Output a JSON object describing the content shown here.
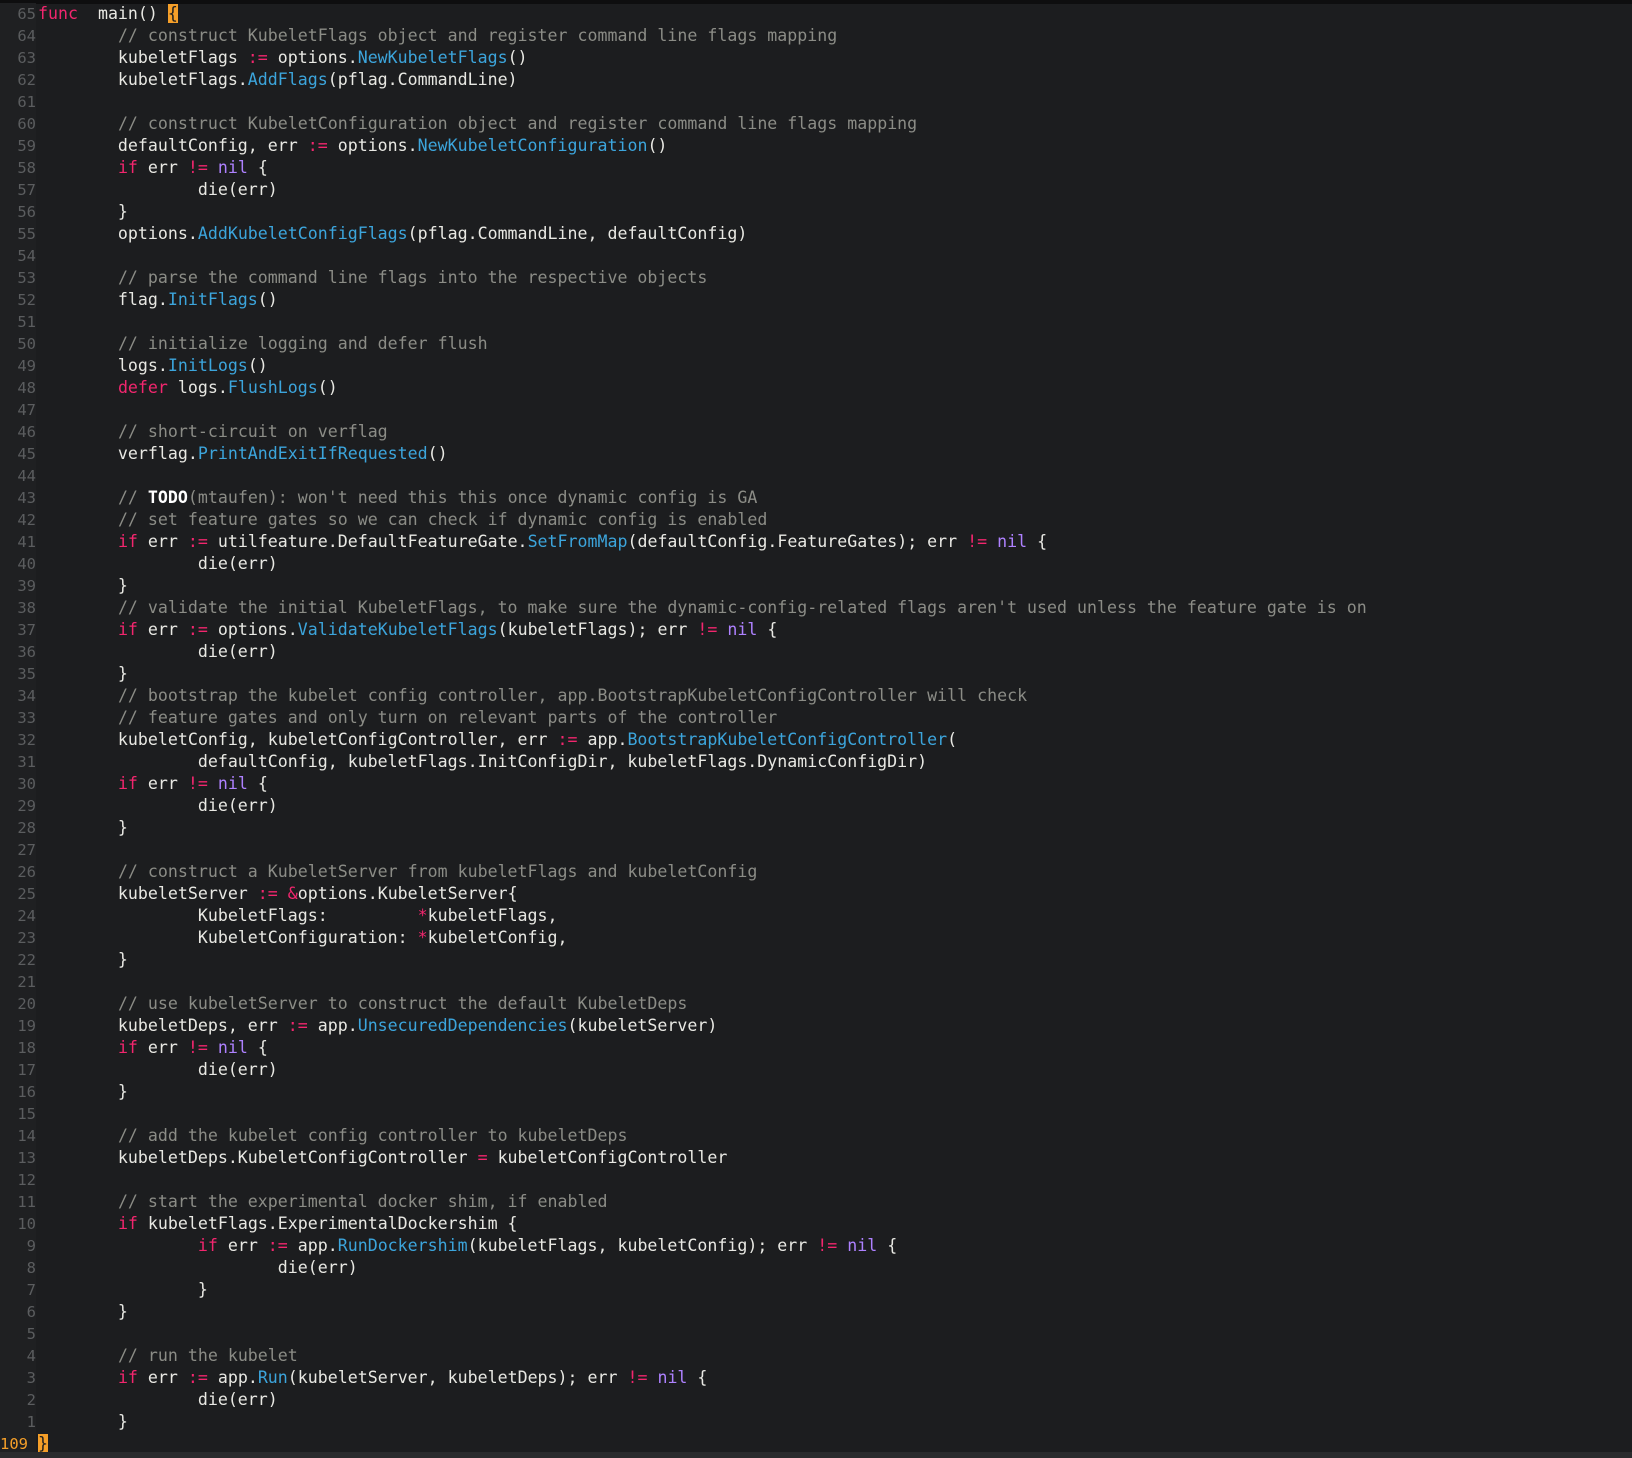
{
  "editor": {
    "language": "go",
    "theme_colors": {
      "background": "#1c1d1f",
      "keyword": "#f2266e",
      "function": "#3ca5dc",
      "literal": "#ae81ff",
      "comment": "#8b8c86",
      "text": "#e8e8e3",
      "current_line_number": "#f59f29",
      "gutter_number": "#5b5d5f"
    },
    "lines": [
      {
        "n": "65",
        "current": false,
        "tokens": [
          [
            "kw",
            "func"
          ],
          [
            "",
            "  main() "
          ],
          [
            "brace",
            "{"
          ]
        ]
      },
      {
        "n": "64",
        "tokens": [
          [
            "",
            "        "
          ],
          [
            "cm",
            "// construct KubeletFlags object and register command line flags mapping"
          ]
        ]
      },
      {
        "n": "63",
        "tokens": [
          [
            "",
            "        kubeletFlags "
          ],
          [
            "op",
            ":="
          ],
          [
            "",
            " options."
          ],
          [
            "fn",
            "NewKubeletFlags"
          ],
          [
            "",
            "()"
          ]
        ]
      },
      {
        "n": "62",
        "tokens": [
          [
            "",
            "        kubeletFlags."
          ],
          [
            "fn",
            "AddFlags"
          ],
          [
            "",
            "(pflag.CommandLine)"
          ]
        ]
      },
      {
        "n": "61",
        "tokens": []
      },
      {
        "n": "60",
        "tokens": [
          [
            "",
            "        "
          ],
          [
            "cm",
            "// construct KubeletConfiguration object and register command line flags mapping"
          ]
        ]
      },
      {
        "n": "59",
        "tokens": [
          [
            "",
            "        defaultConfig, err "
          ],
          [
            "op",
            ":="
          ],
          [
            "",
            " options."
          ],
          [
            "fn",
            "NewKubeletConfiguration"
          ],
          [
            "",
            "()"
          ]
        ]
      },
      {
        "n": "58",
        "tokens": [
          [
            "",
            "        "
          ],
          [
            "kw",
            "if"
          ],
          [
            "",
            " err "
          ],
          [
            "op",
            "!="
          ],
          [
            "",
            " "
          ],
          [
            "lit",
            "nil"
          ],
          [
            "",
            " {"
          ]
        ]
      },
      {
        "n": "57",
        "tokens": [
          [
            "",
            "                die(err)"
          ]
        ]
      },
      {
        "n": "56",
        "tokens": [
          [
            "",
            "        }"
          ]
        ]
      },
      {
        "n": "55",
        "tokens": [
          [
            "",
            "        options."
          ],
          [
            "fn",
            "AddKubeletConfigFlags"
          ],
          [
            "",
            "(pflag.CommandLine, defaultConfig)"
          ]
        ]
      },
      {
        "n": "54",
        "tokens": []
      },
      {
        "n": "53",
        "tokens": [
          [
            "",
            "        "
          ],
          [
            "cm",
            "// parse the command line flags into the respective objects"
          ]
        ]
      },
      {
        "n": "52",
        "tokens": [
          [
            "",
            "        flag."
          ],
          [
            "fn",
            "InitFlags"
          ],
          [
            "",
            "()"
          ]
        ]
      },
      {
        "n": "51",
        "tokens": []
      },
      {
        "n": "50",
        "tokens": [
          [
            "",
            "        "
          ],
          [
            "cm",
            "// initialize logging and defer flush"
          ]
        ]
      },
      {
        "n": "49",
        "tokens": [
          [
            "",
            "        logs."
          ],
          [
            "fn",
            "InitLogs"
          ],
          [
            "",
            "()"
          ]
        ]
      },
      {
        "n": "48",
        "tokens": [
          [
            "",
            "        "
          ],
          [
            "kw",
            "defer"
          ],
          [
            "",
            " logs."
          ],
          [
            "fn",
            "FlushLogs"
          ],
          [
            "",
            "()"
          ]
        ]
      },
      {
        "n": "47",
        "tokens": []
      },
      {
        "n": "46",
        "tokens": [
          [
            "",
            "        "
          ],
          [
            "cm",
            "// short-circuit on verflag"
          ]
        ]
      },
      {
        "n": "45",
        "tokens": [
          [
            "",
            "        verflag."
          ],
          [
            "fn",
            "PrintAndExitIfRequested"
          ],
          [
            "",
            "()"
          ]
        ]
      },
      {
        "n": "44",
        "tokens": []
      },
      {
        "n": "43",
        "tokens": [
          [
            "",
            "        "
          ],
          [
            "cm",
            "// "
          ],
          [
            "todo",
            "TODO"
          ],
          [
            "cm",
            "(mtaufen): won't need this this once dynamic config is GA"
          ]
        ]
      },
      {
        "n": "42",
        "tokens": [
          [
            "",
            "        "
          ],
          [
            "cm",
            "// set feature gates so we can check if dynamic config is enabled"
          ]
        ]
      },
      {
        "n": "41",
        "tokens": [
          [
            "",
            "        "
          ],
          [
            "kw",
            "if"
          ],
          [
            "",
            " err "
          ],
          [
            "op",
            ":="
          ],
          [
            "",
            " utilfeature.DefaultFeatureGate."
          ],
          [
            "fn",
            "SetFromMap"
          ],
          [
            "",
            "(defaultConfig.FeatureGates); err "
          ],
          [
            "op",
            "!="
          ],
          [
            "",
            " "
          ],
          [
            "lit",
            "nil"
          ],
          [
            "",
            " {"
          ]
        ]
      },
      {
        "n": "40",
        "tokens": [
          [
            "",
            "                die(err)"
          ]
        ]
      },
      {
        "n": "39",
        "tokens": [
          [
            "",
            "        }"
          ]
        ]
      },
      {
        "n": "38",
        "tokens": [
          [
            "",
            "        "
          ],
          [
            "cm",
            "// validate the initial KubeletFlags, to make sure the dynamic-config-related flags aren't used unless the feature gate is on"
          ]
        ]
      },
      {
        "n": "37",
        "tokens": [
          [
            "",
            "        "
          ],
          [
            "kw",
            "if"
          ],
          [
            "",
            " err "
          ],
          [
            "op",
            ":="
          ],
          [
            "",
            " options."
          ],
          [
            "fn",
            "ValidateKubeletFlags"
          ],
          [
            "",
            "(kubeletFlags); err "
          ],
          [
            "op",
            "!="
          ],
          [
            "",
            " "
          ],
          [
            "lit",
            "nil"
          ],
          [
            "",
            " {"
          ]
        ]
      },
      {
        "n": "36",
        "tokens": [
          [
            "",
            "                die(err)"
          ]
        ]
      },
      {
        "n": "35",
        "tokens": [
          [
            "",
            "        }"
          ]
        ]
      },
      {
        "n": "34",
        "tokens": [
          [
            "",
            "        "
          ],
          [
            "cm",
            "// bootstrap the kubelet config controller, app.BootstrapKubeletConfigController will check"
          ]
        ]
      },
      {
        "n": "33",
        "tokens": [
          [
            "",
            "        "
          ],
          [
            "cm",
            "// feature gates and only turn on relevant parts of the controller"
          ]
        ]
      },
      {
        "n": "32",
        "tokens": [
          [
            "",
            "        kubeletConfig, kubeletConfigController, err "
          ],
          [
            "op",
            ":="
          ],
          [
            "",
            " app."
          ],
          [
            "fn",
            "BootstrapKubeletConfigController"
          ],
          [
            "",
            "("
          ]
        ]
      },
      {
        "n": "31",
        "tokens": [
          [
            "",
            "                defaultConfig, kubeletFlags.InitConfigDir, kubeletFlags.DynamicConfigDir)"
          ]
        ]
      },
      {
        "n": "30",
        "tokens": [
          [
            "",
            "        "
          ],
          [
            "kw",
            "if"
          ],
          [
            "",
            " err "
          ],
          [
            "op",
            "!="
          ],
          [
            "",
            " "
          ],
          [
            "lit",
            "nil"
          ],
          [
            "",
            " {"
          ]
        ]
      },
      {
        "n": "29",
        "tokens": [
          [
            "",
            "                die(err)"
          ]
        ]
      },
      {
        "n": "28",
        "tokens": [
          [
            "",
            "        }"
          ]
        ]
      },
      {
        "n": "27",
        "tokens": []
      },
      {
        "n": "26",
        "tokens": [
          [
            "",
            "        "
          ],
          [
            "cm",
            "// construct a KubeletServer from kubeletFlags and kubeletConfig"
          ]
        ]
      },
      {
        "n": "25",
        "tokens": [
          [
            "",
            "        kubeletServer "
          ],
          [
            "op",
            ":="
          ],
          [
            "",
            " "
          ],
          [
            "op",
            "&"
          ],
          [
            "",
            "options.KubeletServer{"
          ]
        ]
      },
      {
        "n": "24",
        "tokens": [
          [
            "",
            "                KubeletFlags:         "
          ],
          [
            "op",
            "*"
          ],
          [
            "",
            "kubeletFlags,"
          ]
        ]
      },
      {
        "n": "23",
        "tokens": [
          [
            "",
            "                KubeletConfiguration: "
          ],
          [
            "op",
            "*"
          ],
          [
            "",
            "kubeletConfig,"
          ]
        ]
      },
      {
        "n": "22",
        "tokens": [
          [
            "",
            "        }"
          ]
        ]
      },
      {
        "n": "21",
        "tokens": []
      },
      {
        "n": "20",
        "tokens": [
          [
            "",
            "        "
          ],
          [
            "cm",
            "// use kubeletServer to construct the default KubeletDeps"
          ]
        ]
      },
      {
        "n": "19",
        "tokens": [
          [
            "",
            "        kubeletDeps, err "
          ],
          [
            "op",
            ":="
          ],
          [
            "",
            " app."
          ],
          [
            "fn",
            "UnsecuredDependencies"
          ],
          [
            "",
            "(kubeletServer)"
          ]
        ]
      },
      {
        "n": "18",
        "tokens": [
          [
            "",
            "        "
          ],
          [
            "kw",
            "if"
          ],
          [
            "",
            " err "
          ],
          [
            "op",
            "!="
          ],
          [
            "",
            " "
          ],
          [
            "lit",
            "nil"
          ],
          [
            "",
            " {"
          ]
        ]
      },
      {
        "n": "17",
        "tokens": [
          [
            "",
            "                die(err)"
          ]
        ]
      },
      {
        "n": "16",
        "tokens": [
          [
            "",
            "        }"
          ]
        ]
      },
      {
        "n": "15",
        "tokens": []
      },
      {
        "n": "14",
        "tokens": [
          [
            "",
            "        "
          ],
          [
            "cm",
            "// add the kubelet config controller to kubeletDeps"
          ]
        ]
      },
      {
        "n": "13",
        "tokens": [
          [
            "",
            "        kubeletDeps.KubeletConfigController "
          ],
          [
            "op",
            "="
          ],
          [
            "",
            " kubeletConfigController"
          ]
        ]
      },
      {
        "n": "12",
        "tokens": []
      },
      {
        "n": "11",
        "tokens": [
          [
            "",
            "        "
          ],
          [
            "cm",
            "// start the experimental docker shim, if enabled"
          ]
        ]
      },
      {
        "n": "10",
        "tokens": [
          [
            "",
            "        "
          ],
          [
            "kw",
            "if"
          ],
          [
            "",
            " kubeletFlags.ExperimentalDockershim {"
          ]
        ]
      },
      {
        "n": "9",
        "tokens": [
          [
            "",
            "                "
          ],
          [
            "kw",
            "if"
          ],
          [
            "",
            " err "
          ],
          [
            "op",
            ":="
          ],
          [
            "",
            " app."
          ],
          [
            "fn",
            "RunDockershim"
          ],
          [
            "",
            "(kubeletFlags, kubeletConfig); err "
          ],
          [
            "op",
            "!="
          ],
          [
            "",
            " "
          ],
          [
            "lit",
            "nil"
          ],
          [
            "",
            " {"
          ]
        ]
      },
      {
        "n": "8",
        "tokens": [
          [
            "",
            "                        die(err)"
          ]
        ]
      },
      {
        "n": "7",
        "tokens": [
          [
            "",
            "                }"
          ]
        ]
      },
      {
        "n": "6",
        "tokens": [
          [
            "",
            "        }"
          ]
        ]
      },
      {
        "n": "5",
        "tokens": []
      },
      {
        "n": "4",
        "tokens": [
          [
            "",
            "        "
          ],
          [
            "cm",
            "// run the kubelet"
          ]
        ]
      },
      {
        "n": "3",
        "tokens": [
          [
            "",
            "        "
          ],
          [
            "kw",
            "if"
          ],
          [
            "",
            " err "
          ],
          [
            "op",
            ":="
          ],
          [
            "",
            " app."
          ],
          [
            "fn",
            "Run"
          ],
          [
            "",
            "(kubeletServer, kubeletDeps); err "
          ],
          [
            "op",
            "!="
          ],
          [
            "",
            " "
          ],
          [
            "lit",
            "nil"
          ],
          [
            "",
            " {"
          ]
        ]
      },
      {
        "n": "2",
        "tokens": [
          [
            "",
            "                die(err)"
          ]
        ]
      },
      {
        "n": "1",
        "tokens": [
          [
            "",
            "        }"
          ]
        ]
      },
      {
        "n": "109",
        "current": true,
        "tokens": [
          [
            "brace",
            "}"
          ]
        ]
      }
    ]
  }
}
